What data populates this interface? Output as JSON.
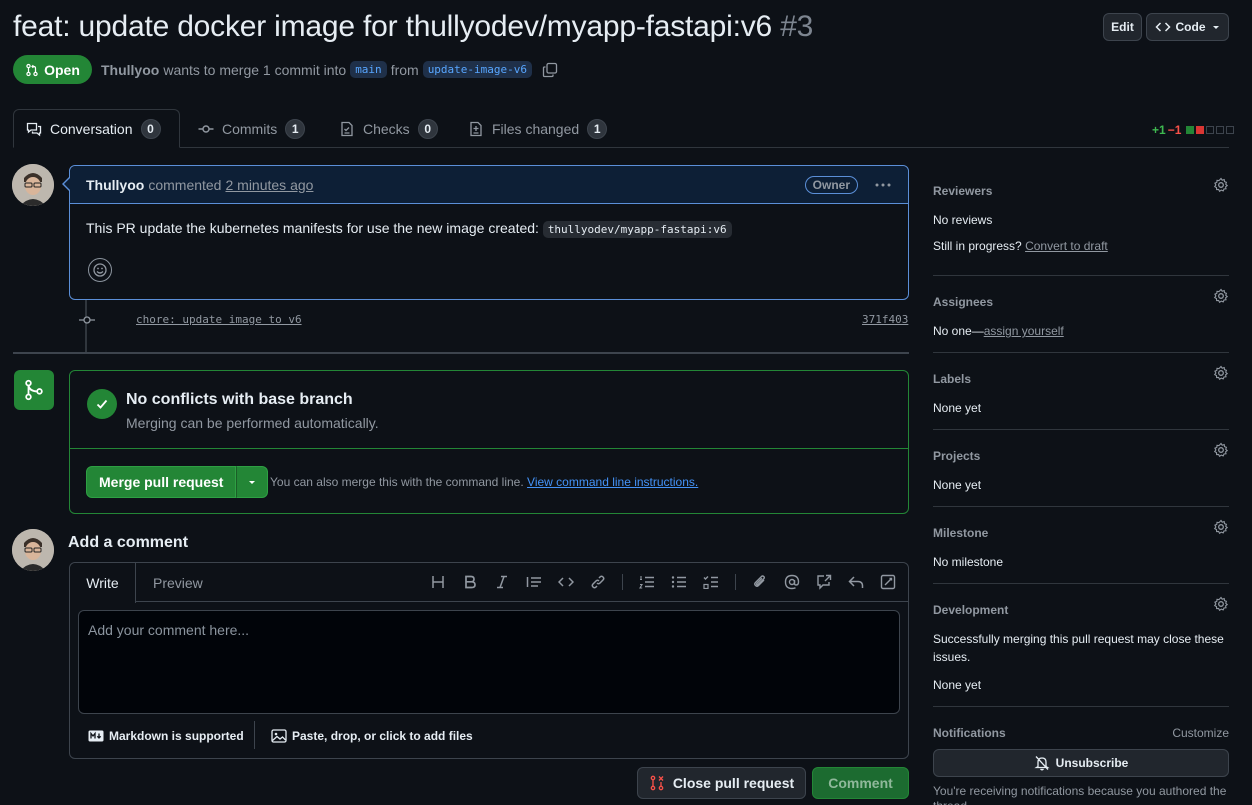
{
  "header": {
    "title": "feat: update docker image for thullyodev/myapp-fastapi:v6",
    "number": "#3",
    "edit_label": "Edit",
    "code_label": "Code"
  },
  "status": {
    "label": "Open",
    "author": "Thullyoo",
    "text_wants": "wants to merge 1 commit into",
    "base_branch": "main",
    "text_from": "from",
    "head_branch": "update-image-v6"
  },
  "tabs": [
    {
      "label": "Conversation",
      "count": "0"
    },
    {
      "label": "Commits",
      "count": "1"
    },
    {
      "label": "Checks",
      "count": "0"
    },
    {
      "label": "Files changed",
      "count": "1"
    }
  ],
  "diffstat": {
    "additions": "+1",
    "deletions": "−1"
  },
  "comment": {
    "author": "Thullyoo",
    "action": "commented",
    "time": "2 minutes ago",
    "badge": "Owner",
    "body": "This PR update the kubernetes manifests for use the new image created:",
    "code": "thullyodev/myapp-fastapi:v6"
  },
  "commit": {
    "message": "chore: update image to v6",
    "sha": "371f403"
  },
  "merge": {
    "heading": "No conflicts with base branch",
    "subtext": "Merging can be performed automatically.",
    "button": "Merge pull request",
    "hint": "You can also merge this with the command line.",
    "hint_link": "View command line instructions."
  },
  "add_comment": {
    "title": "Add a comment",
    "tab_write": "Write",
    "tab_preview": "Preview",
    "placeholder": "Add your comment here...",
    "markdown_note": "Markdown is supported",
    "attach_note": "Paste, drop, or click to add files",
    "close_button": "Close pull request",
    "comment_button": "Comment"
  },
  "sidebar": {
    "reviewers": {
      "title": "Reviewers",
      "value": "No reviews",
      "draft_text": "Still in progress?",
      "draft_link": "Convert to draft"
    },
    "assignees": {
      "title": "Assignees",
      "value": "No one—",
      "link": "assign yourself"
    },
    "labels": {
      "title": "Labels",
      "value": "None yet"
    },
    "projects": {
      "title": "Projects",
      "value": "None yet"
    },
    "milestone": {
      "title": "Milestone",
      "value": "No milestone"
    },
    "development": {
      "title": "Development",
      "value": "Successfully merging this pull request may close these issues.",
      "value2": "None yet"
    },
    "notifications": {
      "title": "Notifications",
      "customize": "Customize",
      "button": "Unsubscribe",
      "note": "You're receiving notifications because you authored the thread."
    }
  },
  "colors": {
    "accent_green": "#238636",
    "link_blue": "#4493f8",
    "background": "#0d1117"
  }
}
